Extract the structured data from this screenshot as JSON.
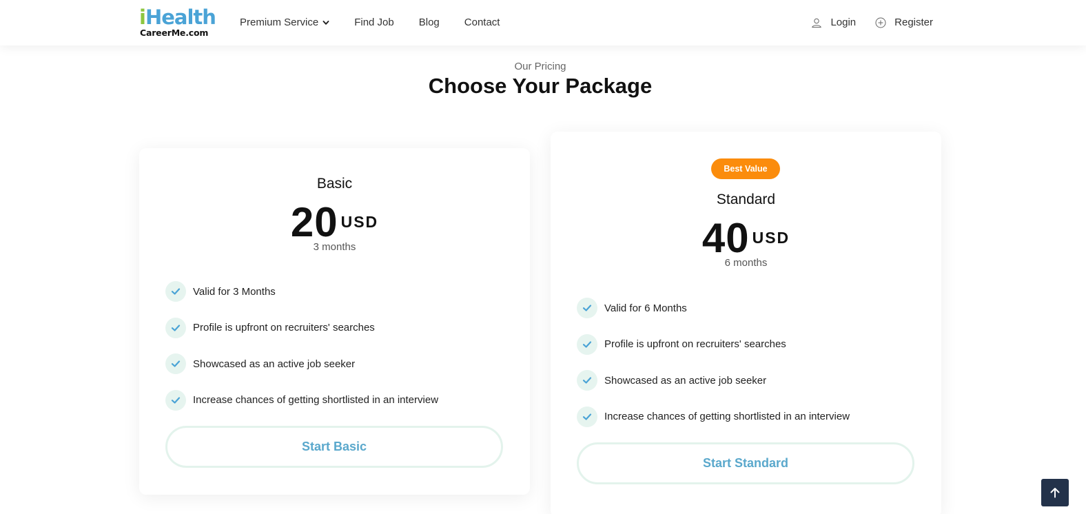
{
  "brand": {
    "logo_main_i": "i",
    "logo_main_rest": "Health",
    "logo_sub": "CareerMe.com",
    "colors": {
      "logo_green": "#8cc63f",
      "logo_blue": "#4aa3d6",
      "badge": "#fb8c0c",
      "button_text": "#5aa8cc",
      "check_bg": "#e6f4ef",
      "check_icon": "#4aa3d6"
    }
  },
  "nav": {
    "items": [
      {
        "label": "Premium Service",
        "has_dropdown": true,
        "icon": "chevron-down-icon"
      },
      {
        "label": "Find Job"
      },
      {
        "label": "Blog"
      },
      {
        "label": "Contact"
      }
    ],
    "auth": [
      {
        "label": "Login",
        "icon": "user-icon"
      },
      {
        "label": "Register",
        "icon": "plus-circle-icon"
      }
    ]
  },
  "section": {
    "eyebrow": "Our Pricing",
    "title": "Choose Your Package"
  },
  "plans": [
    {
      "name": "Basic",
      "price": "20",
      "currency": "USD",
      "duration": "3 months",
      "features": [
        "Valid for 3 Months",
        "Profile is upfront on recruiters' searches",
        "Showcased as an active job seeker",
        "Increase chances of getting shortlisted in an interview"
      ],
      "cta": "Start Basic"
    },
    {
      "badge": "Best Value",
      "name": "Standard",
      "price": "40",
      "currency": "USD",
      "duration": "6 months",
      "features": [
        "Valid for 6 Months",
        "Profile is upfront on recruiters' searches",
        "Showcased as an active job seeker",
        "Increase chances of getting shortlisted in an interview"
      ],
      "cta": "Start Standard"
    }
  ],
  "scroll_top": {
    "icon": "arrow-up-icon"
  }
}
